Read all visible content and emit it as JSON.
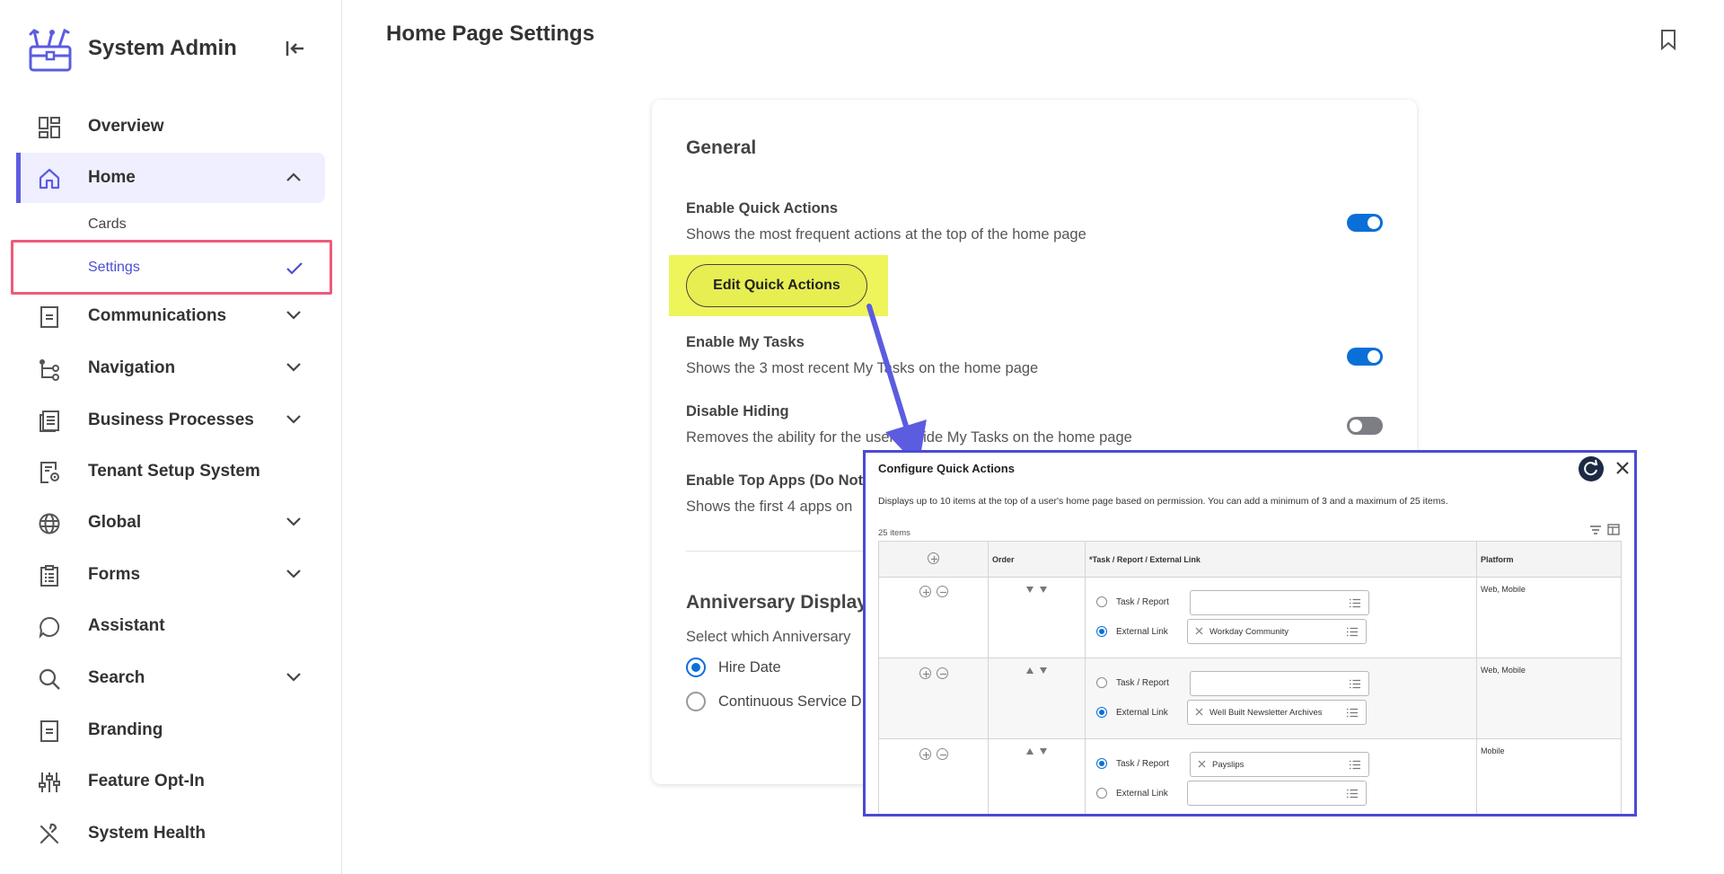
{
  "sidebar": {
    "title": "System Admin",
    "items": [
      {
        "label": "Overview",
        "icon": "grid-icon"
      },
      {
        "label": "Home",
        "icon": "home-icon"
      },
      {
        "label": "Communications",
        "icon": "document-icon"
      },
      {
        "label": "Navigation",
        "icon": "flow-icon"
      },
      {
        "label": "Business Processes",
        "icon": "newspaper-icon"
      },
      {
        "label": "Tenant Setup System",
        "icon": "settings-document-icon"
      },
      {
        "label": "Global",
        "icon": "globe-icon"
      },
      {
        "label": "Forms",
        "icon": "clipboard-icon"
      },
      {
        "label": "Assistant",
        "icon": "chat-bubble-icon"
      },
      {
        "label": "Search",
        "icon": "search-icon"
      },
      {
        "label": "Branding",
        "icon": "document-icon"
      },
      {
        "label": "Feature Opt-In",
        "icon": "sliders-icon"
      },
      {
        "label": "System Health",
        "icon": "tools-icon"
      }
    ],
    "home_sub": [
      {
        "label": "Cards"
      },
      {
        "label": "Settings"
      }
    ],
    "accent_color": "#5b5ce0",
    "highlight_color": "#ee5a7a"
  },
  "main": {
    "page_title": "Home Page Settings",
    "general": {
      "heading": "General",
      "settings": [
        {
          "title": "Enable Quick Actions",
          "desc": "Shows the most frequent actions at the top of the home page",
          "enabled": true
        },
        {
          "title": "Enable My Tasks",
          "desc": "Shows the 3 most recent My Tasks on the home page",
          "enabled": true
        },
        {
          "title": "Disable Hiding",
          "desc": "Removes the ability for the user to hide My Tasks on the home page",
          "enabled": false
        },
        {
          "title": "Enable Top Apps (Do Not",
          "desc": "Shows the first 4 apps on"
        }
      ],
      "edit_button": "Edit Quick Actions"
    },
    "anniversary": {
      "heading": "Anniversary Display",
      "desc": "Select which Anniversary",
      "options": [
        {
          "label": "Hire Date",
          "checked": true
        },
        {
          "label": "Continuous Service D",
          "checked": false
        }
      ]
    }
  },
  "popup": {
    "title": "Configure Quick Actions",
    "desc": "Displays up to 10 items at the top of a user's home page based on permission. You can add a minimum of 3 and a maximum of 25 items.",
    "count": "25 items",
    "columns": [
      "Order",
      "*Task / Report / External Link",
      "Platform"
    ],
    "option_labels": {
      "task": "Task / Report",
      "link": "External Link"
    },
    "rows": [
      {
        "selected": "link",
        "task_value": "",
        "link_value": "Workday Community",
        "platform": "Web, Mobile"
      },
      {
        "selected": "link",
        "task_value": "",
        "link_value": "Well Built Newsletter Archives",
        "platform": "Web, Mobile"
      },
      {
        "selected": "task",
        "task_value": "Payslips",
        "link_value": "",
        "platform": "Mobile"
      }
    ],
    "border_color": "#4a4ad4"
  }
}
